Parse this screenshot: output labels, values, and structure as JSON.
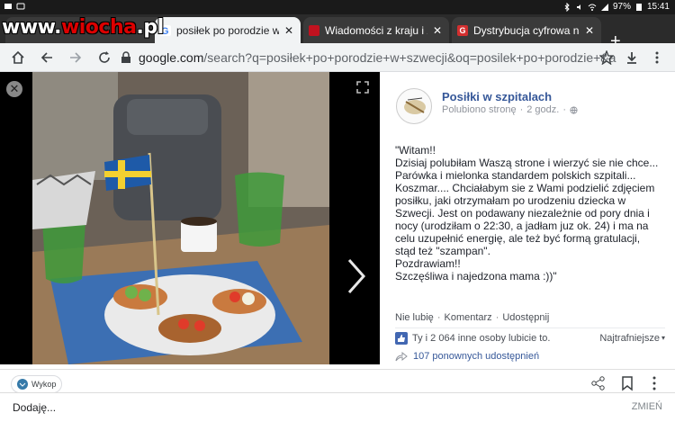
{
  "status_bar": {
    "battery": "97%",
    "time": "15:41"
  },
  "logo": {
    "prefix": "www.",
    "name": "wiocha",
    "suffix": ".pl"
  },
  "tabs": [
    {
      "title": "posiłek po porodzie w s",
      "favicon_color": "#4285f4",
      "active": true
    },
    {
      "title": "Wiadomości z kraju i ze",
      "favicon_color": "#c1121f",
      "active": false
    },
    {
      "title": "Dystrybucja cyfrowa na",
      "favicon_color": "#d32f2f",
      "favicon_letter": "G",
      "active": false
    }
  ],
  "url": {
    "host": "google.com",
    "path": "/search?q=posiłek+po+porodzie+w+szwecji&oq=posilek+po+porodzie+&a"
  },
  "post": {
    "page_name": "Posiłki w szpitalach",
    "liked": "Polubiono stronę",
    "age": "2 godz.",
    "text": [
      "\"Witam!!",
      "Dzisiaj polubiłam Waszą strone i wierzyć sie nie chce... Parówka i mielonka standardem polskich szpitali... Koszmar.... Chciałabym sie z Wami podzielić zdjęciem posiłku, jaki otrzymałam po urodzeniu dziecka w Szwecji. Jest on podawany niezależnie od pory dnia i nocy (urodziłam o 22:30, a jadłam juz ok. 24) i ma na celu uzupełnić energię, ale też być formą gratulacji, stąd też \"szampan\".",
      "Pozdrawiam!!",
      "Szczęśliwa i najedzona mama :))\""
    ],
    "actions": [
      "Nie lubię",
      "Komentarz",
      "Udostępnij"
    ],
    "likes_text": "Ty i 2 064 inne osoby lubicie to.",
    "sort_label": "Najtrafniejsze",
    "shares_text": "107 ponownych udostępnień"
  },
  "bottom": {
    "chip_label": "Wykop"
  },
  "snackbar": {
    "message": "Dodaję...",
    "action": "ZMIEŃ"
  }
}
